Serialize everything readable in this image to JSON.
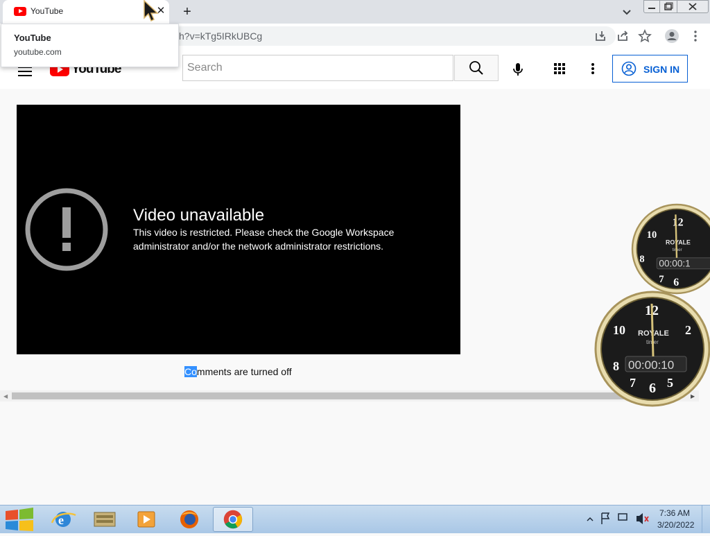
{
  "browser": {
    "tab_title": "YouTube",
    "url_visible": "h?v=kTg5IRkUBCg",
    "tab_hover": {
      "title": "YouTube",
      "domain": "youtube.com"
    }
  },
  "youtube": {
    "logo_text": "YouTube",
    "search_placeholder": "Search",
    "signin_label": "SIGN IN",
    "player": {
      "error_title": "Video unavailable",
      "error_message": "This video is restricted. Please check the Google Workspace administrator and/or the network administrator restrictions."
    },
    "comments": {
      "selected_prefix": "Co",
      "rest": "mments are turned off"
    }
  },
  "gadgets": {
    "clock_brand": "ROYALE",
    "clock_sub": "timer",
    "clock1_readout": "00:00:1",
    "clock2_readout": "00:00:10"
  },
  "taskbar": {
    "time": "7:36 AM",
    "date": "3/20/2022"
  },
  "colors": {
    "yt_red": "#ff0000",
    "yt_blue": "#065fd4",
    "selection_blue": "#3390ff"
  }
}
